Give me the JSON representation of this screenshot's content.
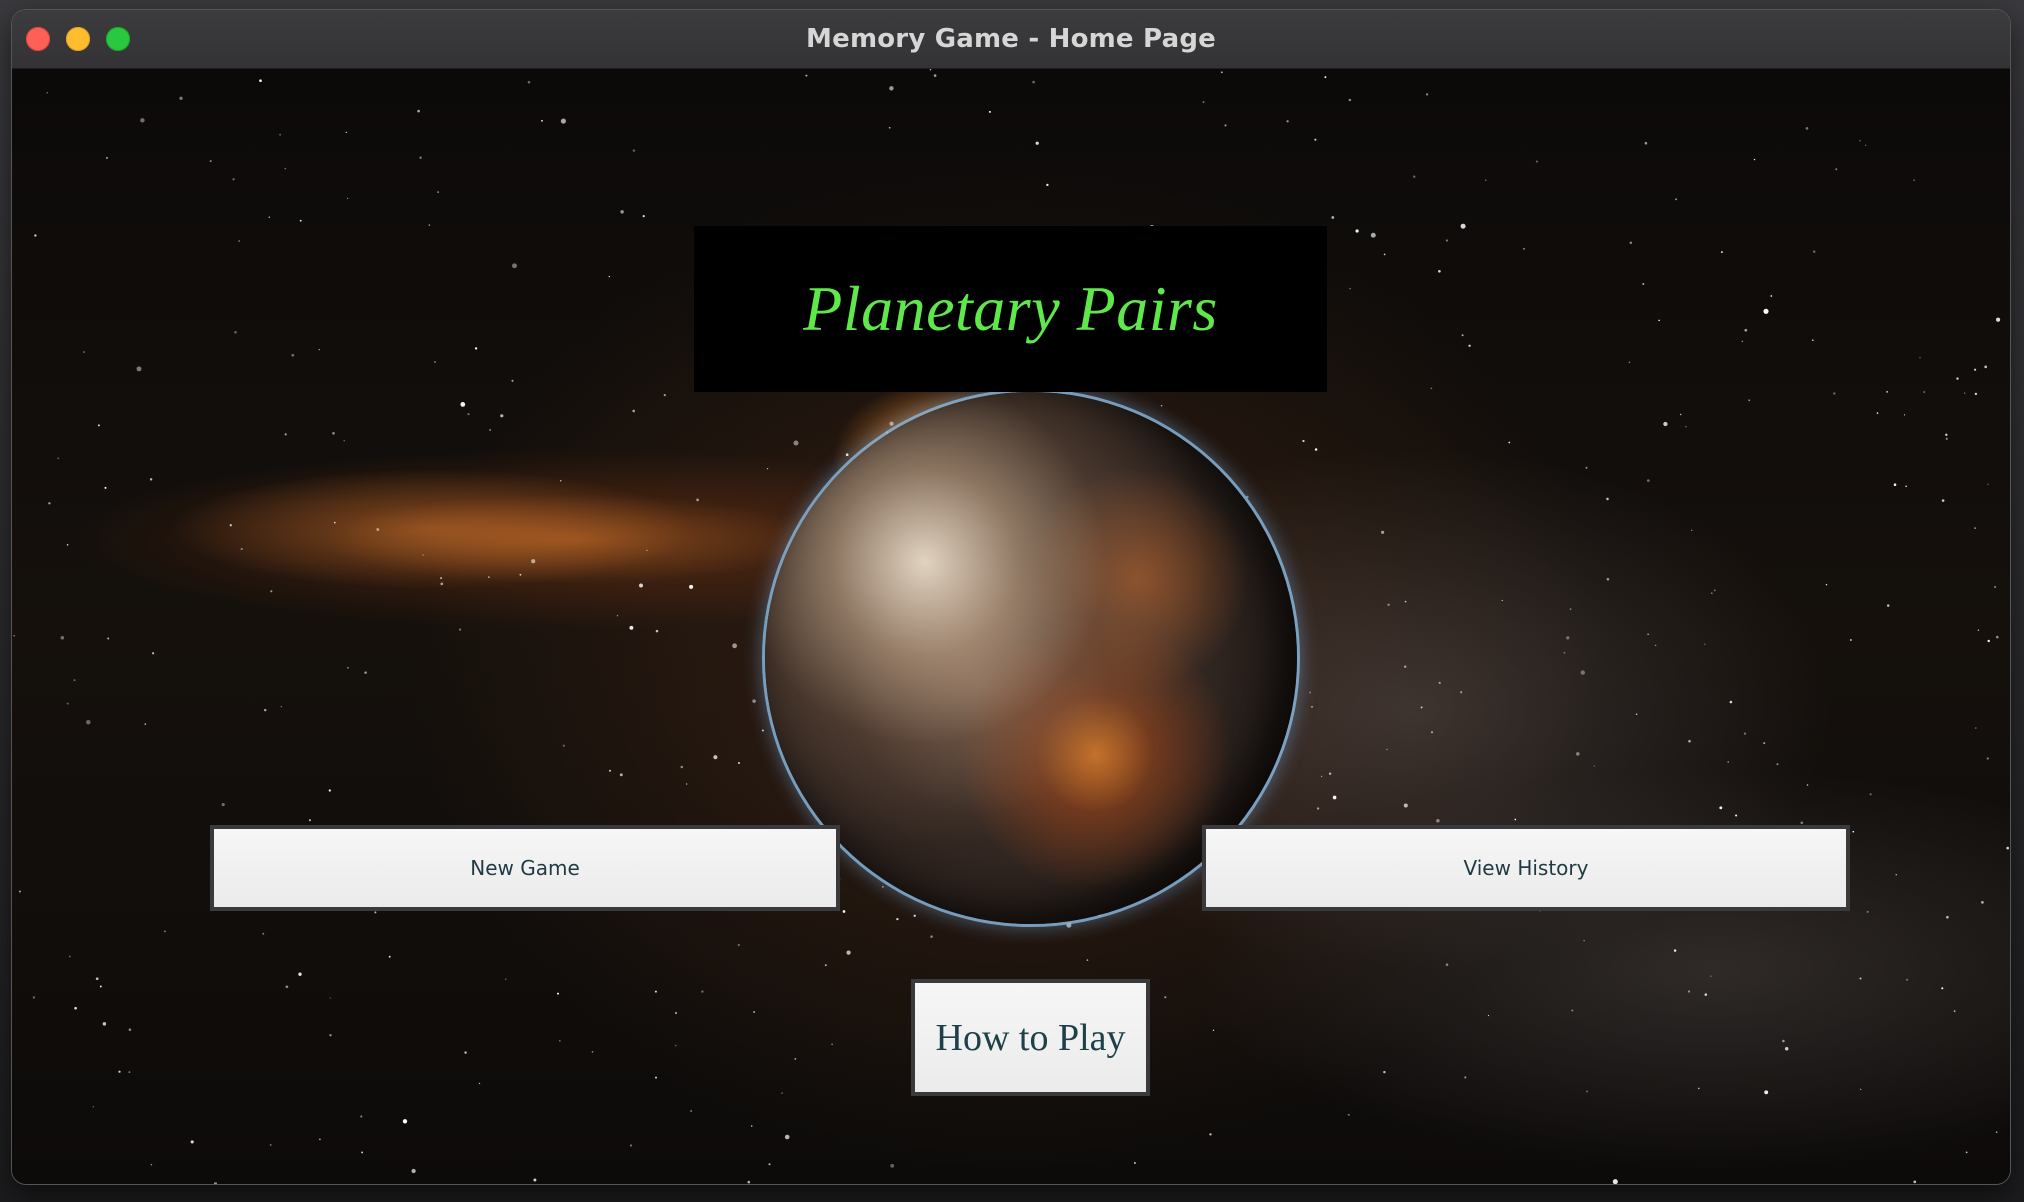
{
  "window": {
    "title": "Memory Game - Home Page",
    "controls": [
      "close",
      "minimize",
      "maximize"
    ]
  },
  "home": {
    "game_title": "Planetary Pairs",
    "buttons": {
      "new_game": "New Game",
      "view_history": "View History",
      "how_to_play": "How to Play"
    }
  },
  "colors": {
    "title_text": "#5ee84a",
    "title_background": "#000000",
    "button_background": "#f0f0f0",
    "button_text": "#1f3a44",
    "button_border": "#3a3a3c"
  },
  "background_image": "space scene with planet"
}
